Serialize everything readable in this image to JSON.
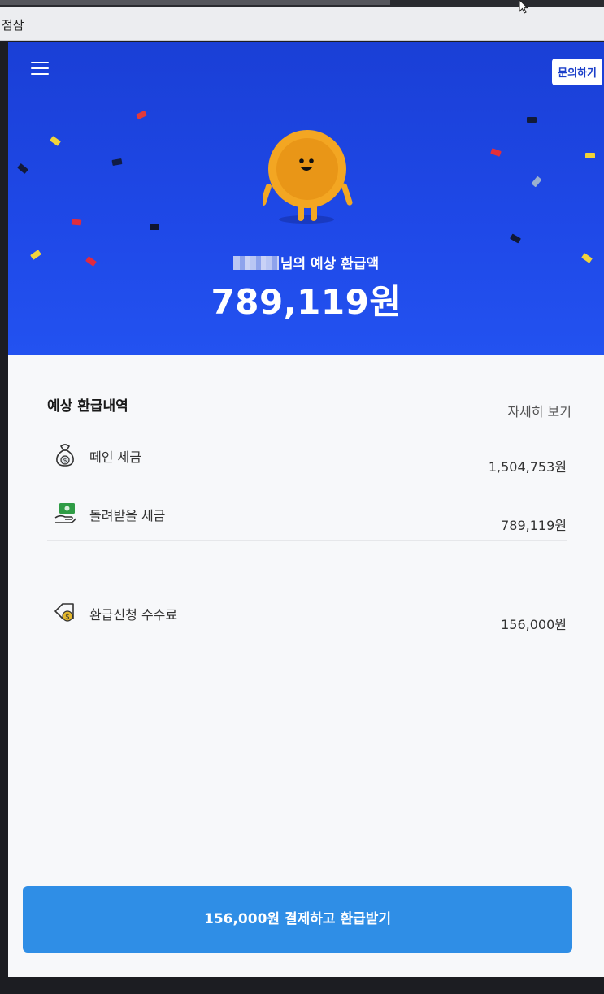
{
  "os": {
    "tab_label": "점삼"
  },
  "header": {
    "inquiry_label": "문의하기"
  },
  "hero": {
    "estimate_label": "님의 예상 환급액",
    "estimate_amount": "789,119원"
  },
  "section": {
    "title": "예상 환급내역",
    "details_link": "자세히 보기"
  },
  "rows": [
    {
      "icon": "money-bag-icon",
      "label": "떼인 세금",
      "amount": "1,504,753원"
    },
    {
      "icon": "cash-hand-icon",
      "label": "돌려받을 세금",
      "amount": "789,119원"
    },
    {
      "icon": "fee-tag-icon",
      "label": "환급신청 수수료",
      "amount": "156,000원"
    }
  ],
  "cta": {
    "label": "156,000원 결제하고 환급받기"
  },
  "colors": {
    "hero_bg": "#1f49e8",
    "cta_bg": "#2f8ee6",
    "coin": "#f2a823"
  }
}
